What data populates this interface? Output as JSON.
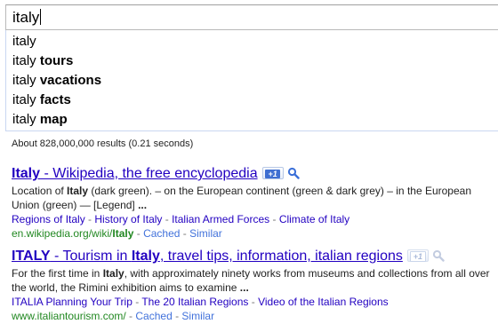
{
  "search": {
    "query": "italy"
  },
  "suggestions": [
    {
      "prefix": "italy",
      "completion": ""
    },
    {
      "prefix": "italy ",
      "completion": "tours"
    },
    {
      "prefix": "italy ",
      "completion": "vacations"
    },
    {
      "prefix": "italy ",
      "completion": "facts"
    },
    {
      "prefix": "italy ",
      "completion": "map"
    }
  ],
  "stats": "About 828,000,000 results (0.21 seconds)",
  "results": [
    {
      "title_bold": "Italy",
      "title_rest": " - Wikipedia, the free encyclopedia",
      "plus_one": "+1",
      "snippet_1": "Location of ",
      "snippet_1_bold": "Italy",
      "snippet_2": " (dark green). – on the European continent (green & dark grey) – in the European Union (green) — [Legend] ",
      "snippet_ellipsis": "...",
      "sitelinks": [
        "Regions of Italy",
        "History of Italy",
        "Italian Armed Forces",
        "Climate of Italy"
      ],
      "url_pre": "en.wikipedia.org/wiki/",
      "url_bold": "Italy",
      "cached": "Cached",
      "similar": "Similar"
    },
    {
      "title_bold1": "ITALY",
      "title_mid": " - Tourism in ",
      "title_bold2": "Italy",
      "title_rest": ", travel tips, information, italian regions",
      "plus_one": "+1",
      "snippet_1": "For the first time in ",
      "snippet_1_bold": "Italy",
      "snippet_2": ", with approximately ninety works from museums and collections from all over the world, the Rimini exhibition aims to examine ",
      "snippet_ellipsis": "...",
      "sitelinks": [
        "ITALIA Planning Your Trip",
        "The 20 Italian Regions",
        "Video of the Italian Regions"
      ],
      "url": "www.italiantourism.com/",
      "cached": "Cached",
      "similar": "Similar"
    }
  ],
  "separator": " - ",
  "colors": {
    "link": "#2200c1",
    "url": "#228822",
    "aux_link": "#4272db",
    "plus_one_active": "#3f6fd1"
  }
}
